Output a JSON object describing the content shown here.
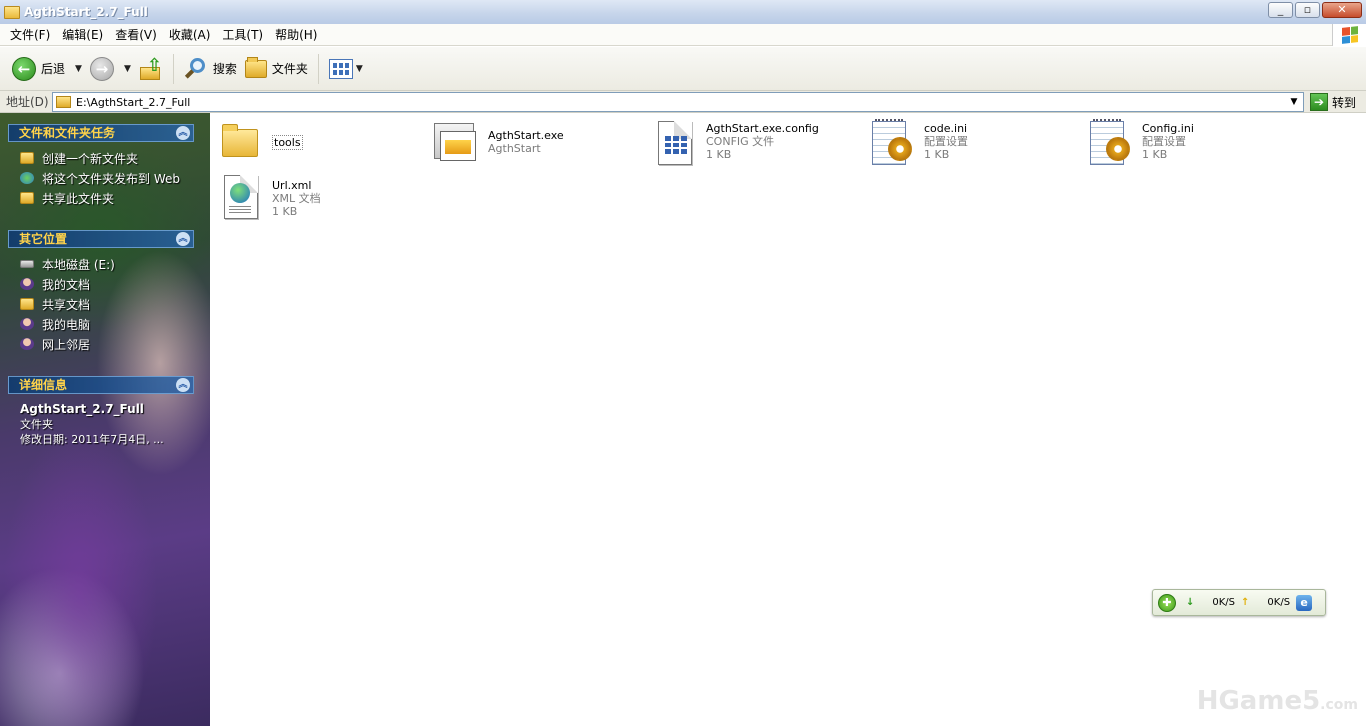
{
  "window": {
    "title": "AgthStart_2.7_Full"
  },
  "menubar": {
    "items": [
      "文件(F)",
      "编辑(E)",
      "查看(V)",
      "收藏(A)",
      "工具(T)",
      "帮助(H)"
    ]
  },
  "toolbar": {
    "back_label": "后退",
    "search_label": "搜索",
    "folders_label": "文件夹"
  },
  "addressbar": {
    "label": "地址(D)",
    "path": "E:\\AgthStart_2.7_Full",
    "go_label": "转到"
  },
  "taskpane": {
    "sections": [
      {
        "title": "文件和文件夹任务",
        "items": [
          "创建一个新文件夹",
          "将这个文件夹发布到 Web",
          "共享此文件夹"
        ]
      },
      {
        "title": "其它位置",
        "items": [
          "本地磁盘 (E:)",
          "我的文档",
          "共享文档",
          "我的电脑",
          "网上邻居"
        ]
      },
      {
        "title": "详细信息"
      }
    ],
    "details": {
      "name": "AgthStart_2.7_Full",
      "type": "文件夹",
      "modified": "修改日期: 2011年7月4日, ..."
    }
  },
  "files": [
    {
      "name": "tools",
      "line2": "",
      "line3": ""
    },
    {
      "name": "AgthStart.exe",
      "line2": "AgthStart",
      "line3": ""
    },
    {
      "name": "AgthStart.exe.config",
      "line2": "CONFIG 文件",
      "line3": "1 KB"
    },
    {
      "name": "code.ini",
      "line2": "配置设置",
      "line3": "1 KB"
    },
    {
      "name": "Config.ini",
      "line2": "配置设置",
      "line3": "1 KB"
    },
    {
      "name": "Url.xml",
      "line2": "XML 文档",
      "line3": "1 KB"
    }
  ],
  "netwidget": {
    "download": "0K/S",
    "upload": "0K/S"
  },
  "watermark": {
    "text": "HGame5",
    "suffix": ".com"
  },
  "icons": {
    "window": "folder-icon",
    "back": "back-arrow-icon",
    "forward": "forward-arrow-icon",
    "up": "folder-up-icon",
    "search": "search-icon",
    "folders": "folder-icon",
    "views": "views-icon"
  }
}
